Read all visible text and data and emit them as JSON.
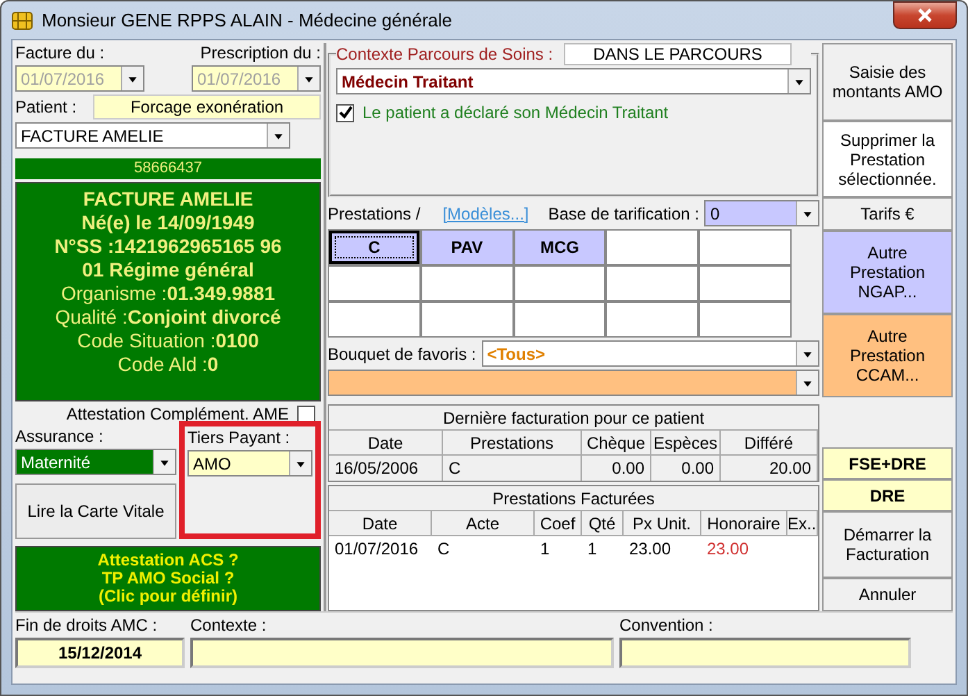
{
  "window": {
    "title": "Monsieur GENE RPPS ALAIN - Médecine générale"
  },
  "left": {
    "invoice_date": {
      "label": "Facture du :",
      "value": "01/07/2016"
    },
    "prescription_date": {
      "label": "Prescription du :",
      "value": "01/07/2016"
    },
    "patient": {
      "label": "Patient :",
      "forcing_button": "Forcage exonération",
      "value": "FACTURE AMELIE"
    },
    "card_number": "58666437",
    "card_lines": [
      {
        "text": "FACTURE AMELIE",
        "bold": true
      },
      {
        "text": "Né(e) le 14/09/1949",
        "bold": true
      },
      {
        "text": "N°SS :1421962965165 96",
        "bold": true
      },
      {
        "text": "01 Régime général",
        "bold": true
      },
      {
        "text": "Organisme :**01.349.9881**",
        "bold": false
      },
      {
        "text": "Qualité :**Conjoint divorcé**",
        "bold": false
      },
      {
        "text": "Code Situation :**0100**",
        "bold": false
      },
      {
        "text": "Code Ald :**0**",
        "bold": false
      }
    ],
    "attestation": {
      "label": "Attestation Complément. AME",
      "checked": false
    },
    "assurance": {
      "label": "Assurance :",
      "value": "Maternité"
    },
    "tiers_payant": {
      "label": "Tiers Payant :",
      "value": "AMO",
      "highlighted": true
    },
    "read_card_button": "Lire la Carte Vitale",
    "acs_panel": [
      "Attestation ACS ?",
      "TP AMO Social ?",
      "(Clic pour définir)"
    ]
  },
  "context": {
    "legend": "Contexte Parcours de Soins  :",
    "status": "DANS LE PARCOURS",
    "value": "Médecin Traitant",
    "declared": {
      "label": "Le patient a déclaré son Médecin Traitant",
      "checked": true
    }
  },
  "prestations": {
    "label": "Prestations /",
    "link": "[Modèles...]",
    "base_label": "Base de tarification :",
    "base_value": "0",
    "cells": [
      {
        "label": "C",
        "selected": true
      },
      {
        "label": "PAV",
        "selected": false
      },
      {
        "label": "MCG",
        "selected": false
      }
    ]
  },
  "favorites": {
    "label": "Bouquet de favoris :",
    "value": "<Tous>"
  },
  "last_billing": {
    "title": "Dernière facturation pour ce patient",
    "columns": [
      "Date",
      "Prestations",
      "Chèque",
      "Espèces",
      "Différé"
    ],
    "rows": [
      [
        "16/05/2006",
        "C",
        "0.00",
        "0.00",
        "20.00"
      ]
    ]
  },
  "billed": {
    "title": "Prestations Facturées",
    "columns": [
      "Date",
      "Acte",
      "Coef",
      "Qté",
      "Px Unit.",
      "Honoraire",
      "Ex..."
    ],
    "rows": [
      [
        "01/07/2016",
        "C",
        "1",
        "1",
        "23.00",
        "23.00",
        ""
      ]
    ]
  },
  "buttons_top": [
    {
      "label": "Saisie des montants AMO",
      "kind": "plain"
    },
    {
      "label": "Supprimer la Prestation sélectionnée.",
      "kind": "white"
    },
    {
      "label": "Tarifs €",
      "kind": "plain"
    },
    {
      "label": "Autre Prestation NGAP...",
      "kind": "blue"
    },
    {
      "label": "Autre Prestation CCAM...",
      "kind": "orange"
    }
  ],
  "buttons_bottom": [
    {
      "label": "FSE+DRE",
      "kind": "yellow"
    },
    {
      "label": "DRE",
      "kind": "yellow"
    },
    {
      "label": "Démarrer la Facturation",
      "kind": "plain"
    },
    {
      "label": "Annuler",
      "kind": "plain"
    }
  ],
  "footer": {
    "rights_end": {
      "label": "Fin de droits AMC :",
      "value": "15/12/2014"
    },
    "context_label": "Contexte :",
    "convention_label": "Convention :"
  }
}
